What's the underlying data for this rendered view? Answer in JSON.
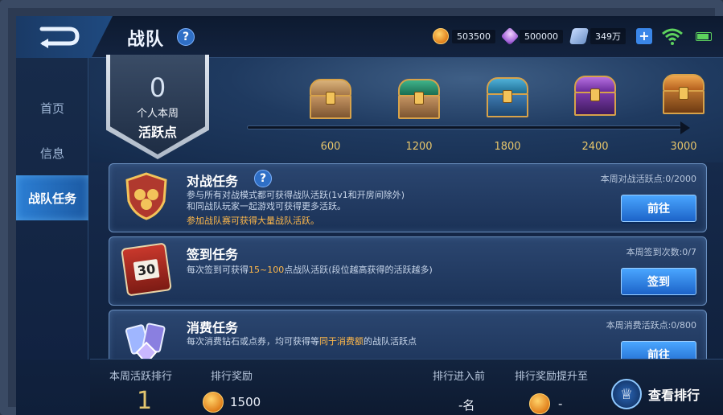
{
  "header": {
    "title": "战队",
    "help_label": "?",
    "currencies": [
      {
        "name": "gold-coin",
        "value": "503500"
      },
      {
        "name": "diamond",
        "value": "500000"
      },
      {
        "name": "coupon",
        "value": "349万"
      }
    ],
    "plus_label": "+"
  },
  "sidebar": {
    "items": [
      {
        "label": "首页",
        "active": false
      },
      {
        "label": "信息",
        "active": false
      },
      {
        "label": "战队任务",
        "active": true
      }
    ]
  },
  "activity": {
    "value": "0",
    "label_line1": "个人本周",
    "label_line2": "活跃点",
    "milestones": [
      "600",
      "1200",
      "1800",
      "2400",
      "3000"
    ],
    "progress": 0
  },
  "tasks": [
    {
      "title": "对战任务",
      "has_help": true,
      "help_label": "?",
      "desc_line1": "参与所有对战模式都可获得战队活跃(1v1和开房间除外)",
      "desc_line2": "和同战队玩家一起游戏可获得更多活跃。",
      "warning": "参加战队赛可获得大量战队活跃。",
      "stat": "本周对战活跃点:0/2000",
      "button": "前往"
    },
    {
      "title": "签到任务",
      "desc_pre": "每次签到可获得",
      "desc_hl": "15~100",
      "desc_post": "点战队活跃(段位越高获得的活跃越多)",
      "stat": "本周签到次数:0/7",
      "button": "签到",
      "icon_text": "30"
    },
    {
      "title": "消费任务",
      "desc_pre": "每次消费钻石或点券，均可获得等",
      "desc_hl": "同于消费额",
      "desc_post": "的战队活跃点",
      "stat": "本周消费活跃点:0/800",
      "button": "前往"
    }
  ],
  "bottom": {
    "rank_label": "本周活跃排行",
    "rank_value": "1",
    "reward_label": "排行奖励",
    "reward_value": "1500",
    "enter_label": "排行进入前",
    "enter_value": "-名",
    "upgrade_label": "排行奖励提升至",
    "upgrade_value": "-",
    "view_rank_label": "查看排行"
  },
  "colors": {
    "accent_blue": "#2c7fd4",
    "highlight_orange": "#ffb84a",
    "gold_text": "#e8c66a"
  }
}
